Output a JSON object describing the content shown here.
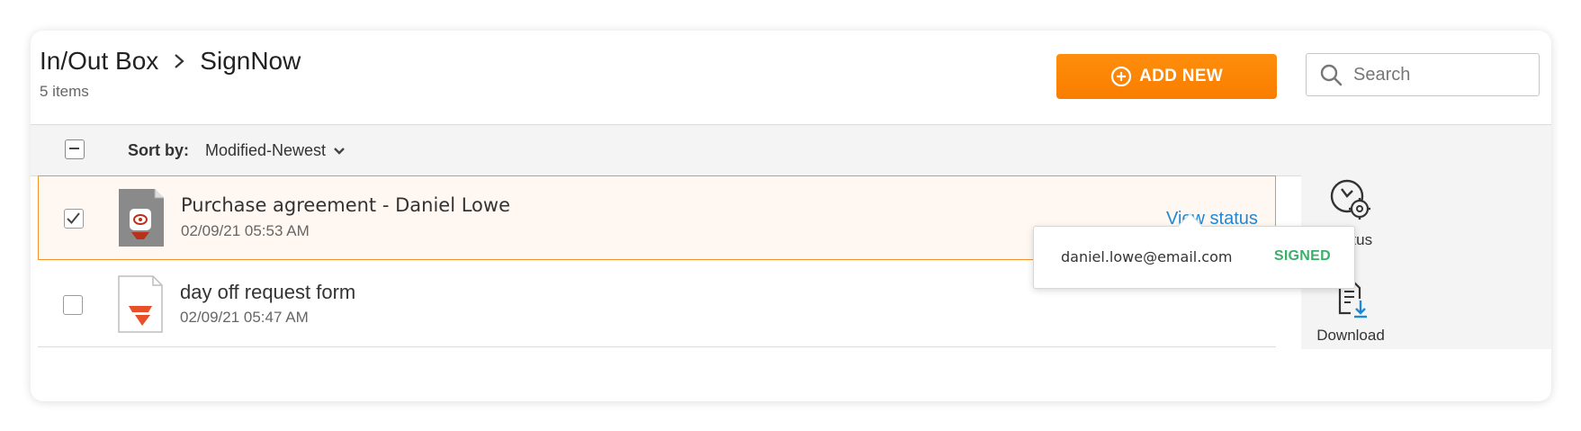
{
  "header": {
    "breadcrumb": [
      "In/Out Box",
      "SignNow"
    ],
    "item_count": "5 items",
    "add_new_label": "ADD NEW",
    "search_placeholder": "Search"
  },
  "sort": {
    "label": "Sort by:",
    "value": "Modified-Newest"
  },
  "documents": [
    {
      "title": "Purchase agreement - Daniel Lowe",
      "date": "02/09/21 05:53 AM",
      "checked": true,
      "view_status_label": "View status"
    },
    {
      "title": "day off request form",
      "date": "02/09/21 05:47 AM",
      "checked": false
    }
  ],
  "popover": {
    "email": "daniel.lowe@email.com",
    "status": "SIGNED"
  },
  "actions": {
    "status_label": "Status",
    "download_label": "Download"
  },
  "colors": {
    "accent_orange": "#f98500",
    "link_blue": "#1f88d6",
    "signed_green": "#3ab06a",
    "selected_border": "#f5922c",
    "brand_red": "#e8502a"
  },
  "icons": {
    "add": "plus-circle-icon",
    "search": "magnifier-icon",
    "status": "clock-gear-icon",
    "download": "document-download-icon"
  }
}
